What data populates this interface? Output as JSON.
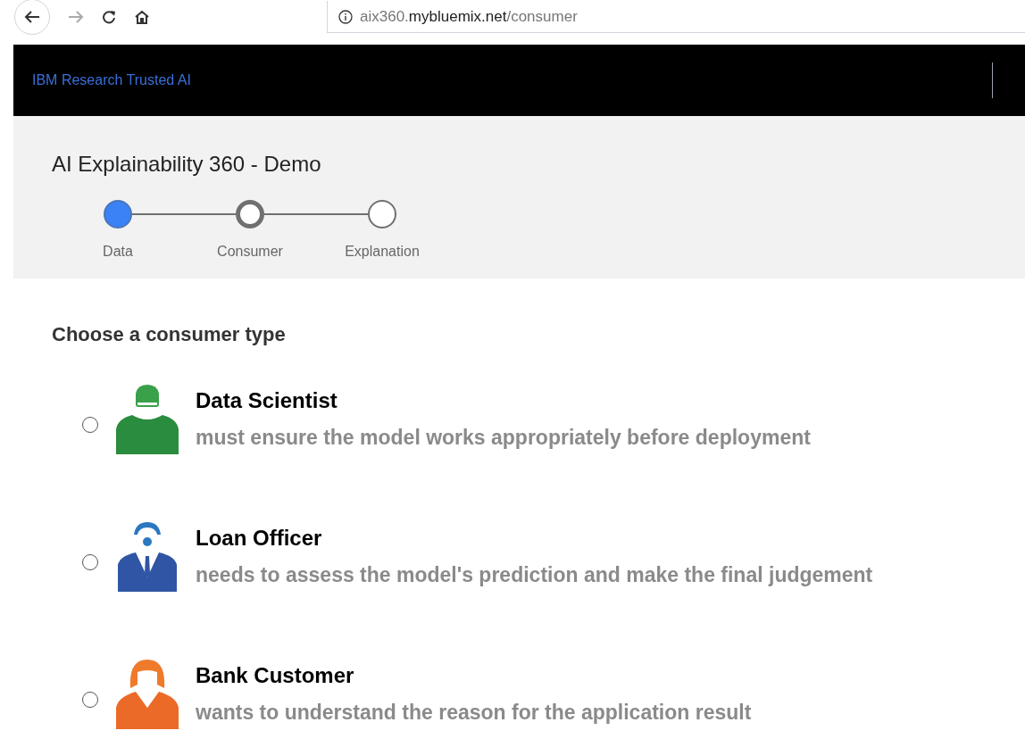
{
  "browser": {
    "url": {
      "prefix": "aix360.",
      "domain": "mybluemix.net",
      "path": "/consumer"
    }
  },
  "header": {
    "brand": "IBM Research Trusted AI"
  },
  "demo": {
    "title": "AI Explainability 360 - Demo",
    "steps": [
      {
        "label": "Data",
        "completed": true,
        "current": false
      },
      {
        "label": "Consumer",
        "completed": false,
        "current": true
      },
      {
        "label": "Explanation",
        "completed": false,
        "current": false
      }
    ]
  },
  "consumer_picker": {
    "heading": "Choose a consumer type",
    "options": [
      {
        "title": "Data Scientist",
        "description": "must ensure the model works appropriately before deployment",
        "selected": false,
        "kind": "scientist"
      },
      {
        "title": "Loan Officer",
        "description": "needs to assess the model's prediction and make the final judgement",
        "selected": false,
        "kind": "officer"
      },
      {
        "title": "Bank Customer",
        "description": "wants to understand the reason for the application result",
        "selected": false,
        "kind": "customer"
      }
    ]
  }
}
